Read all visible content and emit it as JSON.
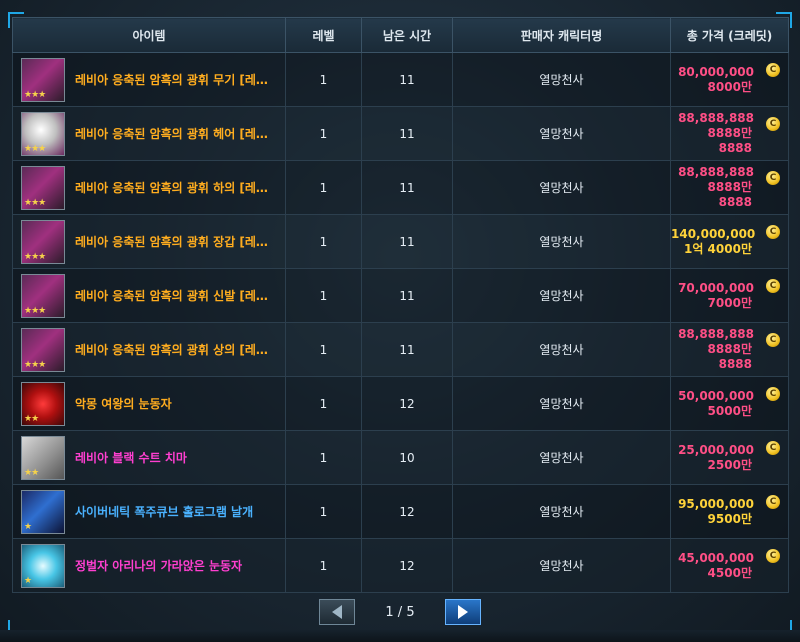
{
  "columns": {
    "item": "아이템",
    "level": "레벨",
    "time": "남은 시간",
    "seller": "판매자 캐릭터명",
    "price": "총 가격 (크레딧)"
  },
  "currency_icon": "credit-coin-icon",
  "rows": [
    {
      "name": "레비아 응축된 암흑의 광휘 무기 [레…",
      "level": "1",
      "time": "11",
      "seller": "열망천사",
      "price": "80,000,000",
      "price_short": "8000만"
    },
    {
      "name": "레비아 응축된 암흑의 광휘 헤어 [레…",
      "level": "1",
      "time": "11",
      "seller": "열망천사",
      "price": "88,888,888",
      "price_short": "8888만 8888"
    },
    {
      "name": "레비아 응축된 암흑의 광휘 하의 [레…",
      "level": "1",
      "time": "11",
      "seller": "열망천사",
      "price": "88,888,888",
      "price_short": "8888만 8888"
    },
    {
      "name": "레비아 응축된 암흑의 광휘 장갑 [레…",
      "level": "1",
      "time": "11",
      "seller": "열망천사",
      "price": "140,000,000",
      "price_short": "1억 4000만"
    },
    {
      "name": "레비아 응축된 암흑의 광휘 신발 [레…",
      "level": "1",
      "time": "11",
      "seller": "열망천사",
      "price": "70,000,000",
      "price_short": "7000만"
    },
    {
      "name": "레비아 응축된 암흑의 광휘 상의 [레…",
      "level": "1",
      "time": "11",
      "seller": "열망천사",
      "price": "88,888,888",
      "price_short": "8888만 8888"
    },
    {
      "name": "악몽 여왕의 눈동자",
      "level": "1",
      "time": "12",
      "seller": "열망천사",
      "price": "50,000,000",
      "price_short": "5000만"
    },
    {
      "name": "레비아 블랙 수트 치마",
      "level": "1",
      "time": "10",
      "seller": "열망천사",
      "price": "25,000,000",
      "price_short": "2500만"
    },
    {
      "name": "사이버네틱 폭주큐브 홀로그램 날개",
      "level": "1",
      "time": "12",
      "seller": "열망천사",
      "price": "95,000,000",
      "price_short": "9500만"
    },
    {
      "name": "정벌자 아리나의 가라앉은 눈동자",
      "level": "1",
      "time": "12",
      "seller": "열망천사",
      "price": "45,000,000",
      "price_short": "4500만"
    }
  ],
  "pager": {
    "current": "1",
    "total": "5",
    "label": "1 / 5"
  }
}
